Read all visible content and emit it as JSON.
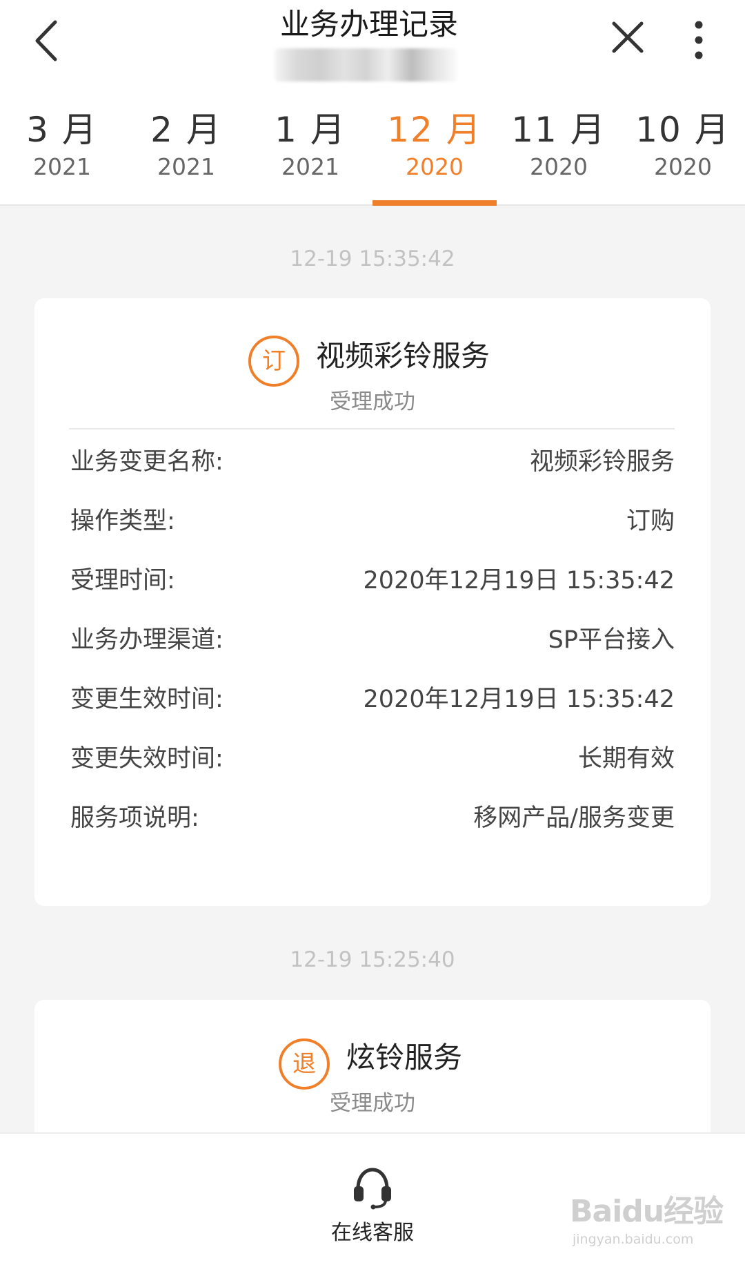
{
  "header": {
    "title": "业务办理记录"
  },
  "months": [
    {
      "month": "3 月",
      "year": "2021",
      "active": false
    },
    {
      "month": "2 月",
      "year": "2021",
      "active": false
    },
    {
      "month": "1 月",
      "year": "2021",
      "active": false
    },
    {
      "month": "12 月",
      "year": "2020",
      "active": true
    },
    {
      "month": "11 月",
      "year": "2020",
      "active": false
    },
    {
      "month": "10 月",
      "year": "2020",
      "active": false
    }
  ],
  "records": [
    {
      "timestamp": "12-19 15:35:42",
      "badge": "订",
      "service": "视频彩铃服务",
      "status": "受理成功",
      "details": [
        {
          "label": "业务变更名称:",
          "value": "视频彩铃服务"
        },
        {
          "label": "操作类型:",
          "value": "订购"
        },
        {
          "label": "受理时间:",
          "value": "2020年12月19日 15:35:42"
        },
        {
          "label": "业务办理渠道:",
          "value": "SP平台接入"
        },
        {
          "label": "变更生效时间:",
          "value": "2020年12月19日 15:35:42"
        },
        {
          "label": "变更失效时间:",
          "value": "长期有效"
        },
        {
          "label": "服务项说明:",
          "value": "移网产品/服务变更"
        }
      ]
    },
    {
      "timestamp": "12-19 15:25:40",
      "badge": "退",
      "service": "炫铃服务",
      "status": "受理成功"
    }
  ],
  "bottom": {
    "service_label": "在线客服"
  },
  "watermark": {
    "main": "Baidu经验",
    "sub": "jingyan.baidu.com"
  },
  "colors": {
    "accent": "#f07f2a",
    "background": "#f4f4f4"
  },
  "icons": [
    "back-arrow-icon",
    "close-icon",
    "more-icon",
    "headset-icon"
  ]
}
